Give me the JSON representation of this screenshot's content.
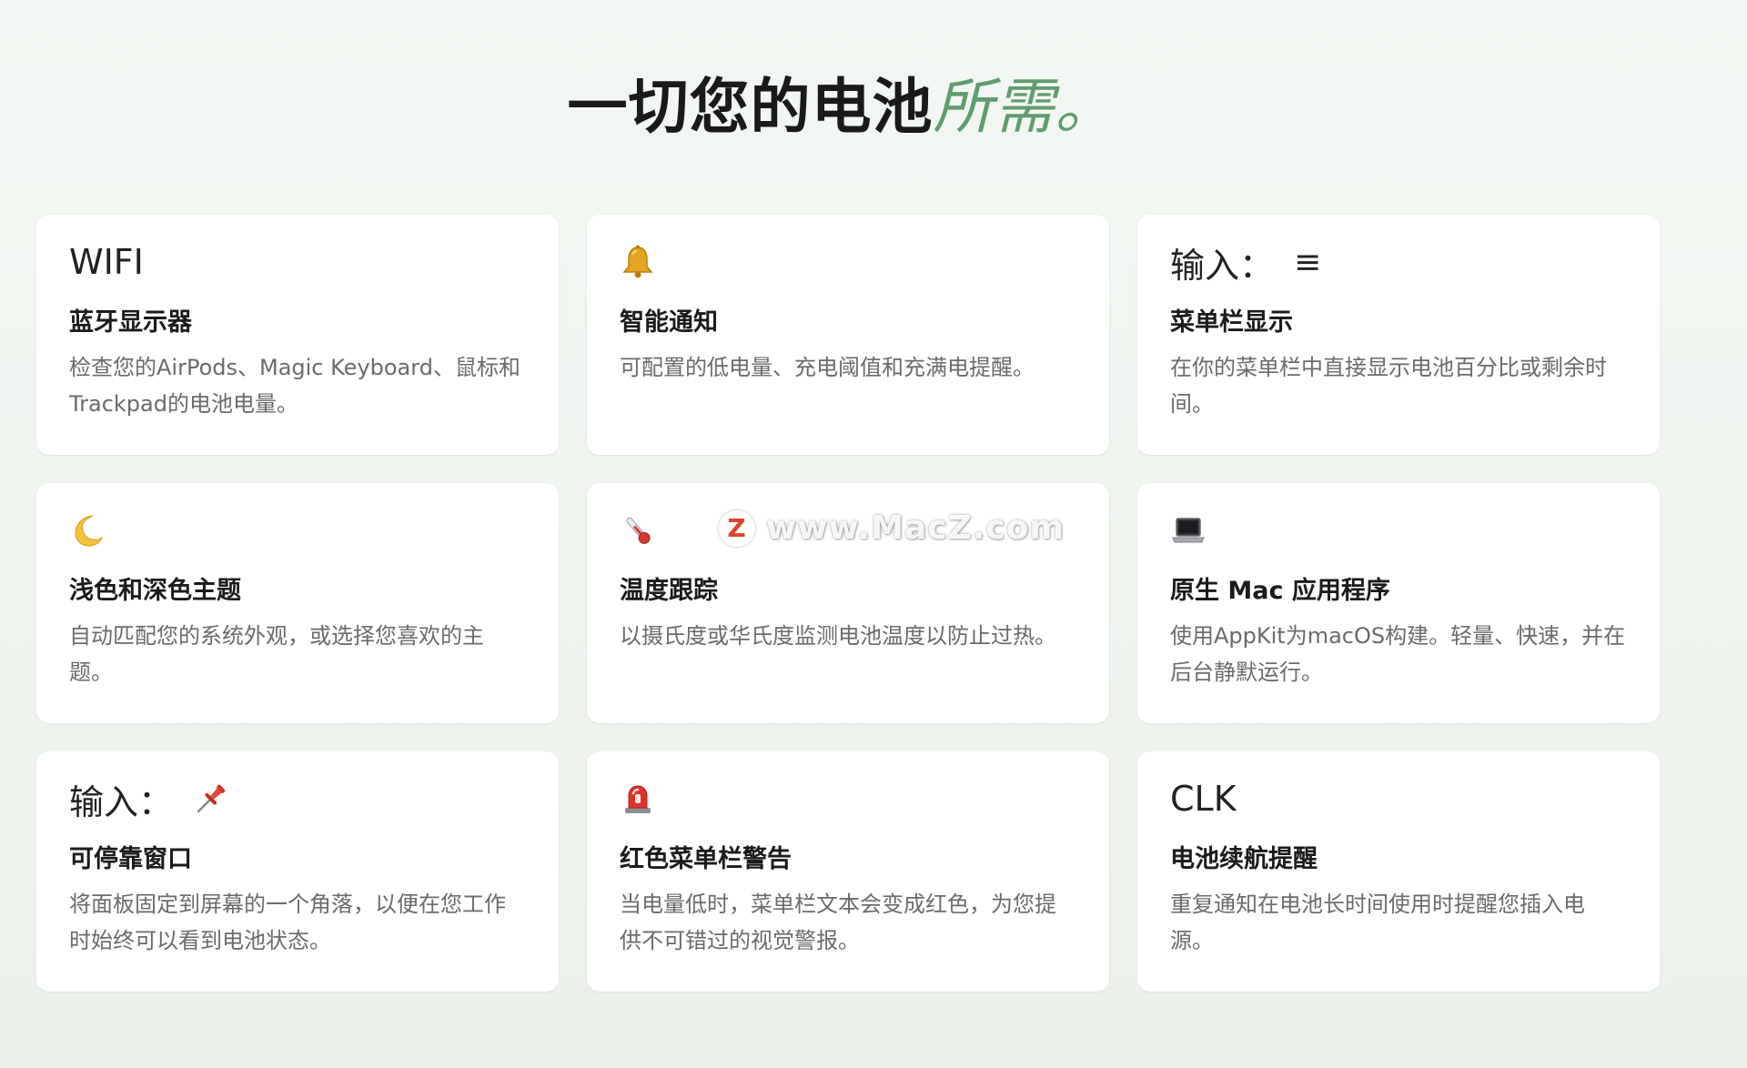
{
  "headline": {
    "main": "一切您的电池",
    "accent": "所需。"
  },
  "cards": [
    {
      "icon_text": "WIFI",
      "icon": "",
      "title": "蓝牙显示器",
      "desc": "检查您的AirPods、Magic Keyboard、鼠标和Trackpad的电池电量。"
    },
    {
      "icon_text": "",
      "icon": "bell-icon",
      "title": "智能通知",
      "desc": "可配置的低电量、充电阈值和充满电提醒。"
    },
    {
      "icon_text": "输入：",
      "icon": "menu-lines-icon",
      "icon_glyph": "≡",
      "title": "菜单栏显示",
      "desc": "在你的菜单栏中直接显示电池百分比或剩余时间。"
    },
    {
      "icon_text": "",
      "icon": "moon-icon",
      "title": "浅色和深色主题",
      "desc": "自动匹配您的系统外观，或选择您喜欢的主题。"
    },
    {
      "icon_text": "",
      "icon": "thermometer-icon",
      "title": "温度跟踪",
      "desc": "以摄氏度或华氏度监测电池温度以防止过热。"
    },
    {
      "icon_text": "",
      "icon": "laptop-icon",
      "title": "原生 Mac 应用程序",
      "desc": "使用AppKit为macOS构建。轻量、快速，并在后台静默运行。"
    },
    {
      "icon_text": "输入：",
      "icon": "pushpin-icon",
      "title": "可停靠窗口",
      "desc": "将面板固定到屏幕的一个角落，以便在您工作时始终可以看到电池状态。"
    },
    {
      "icon_text": "",
      "icon": "siren-icon",
      "title": "红色菜单栏警告",
      "desc": "当电量低时，菜单栏文本会变成红色，为您提供不可错过的视觉警报。"
    },
    {
      "icon_text": "CLK",
      "icon": "",
      "title": "电池续航提醒",
      "desc": "重复通知在电池长时间使用时提醒您插入电源。"
    }
  ],
  "watermark": {
    "logo_letter": "Z",
    "text": "www.MacZ.com"
  },
  "colors": {
    "accent": "#5e9d6f",
    "card_bg": "#ffffff",
    "page_bg": "#eff4ef",
    "desc_text": "#6a6a6a"
  }
}
